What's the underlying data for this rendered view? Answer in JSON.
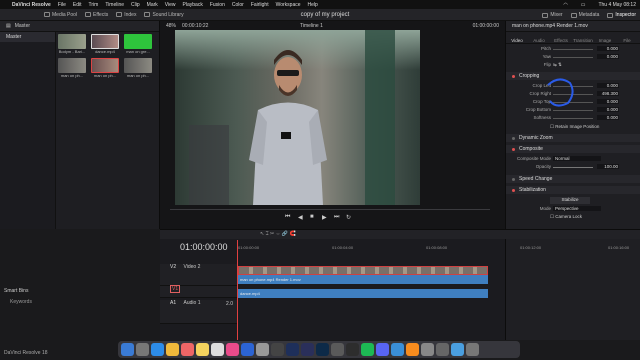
{
  "menubar": {
    "apple": "",
    "app": "DaVinci Resolve",
    "items": [
      "File",
      "Edit",
      "Trim",
      "Timeline",
      "Clip",
      "Mark",
      "View",
      "Playback",
      "Fusion",
      "Color",
      "Fairlight",
      "Workspace",
      "Help"
    ],
    "clock": "Thu 4 May  08:12"
  },
  "toolbar": {
    "media_pool": "Media Pool",
    "effects": "Effects",
    "index": "Index",
    "sound_library": "Sound Library",
    "project_title": "copy of my project",
    "mixer": "Mixer",
    "metadata": "Metadata",
    "inspector": "Inspector"
  },
  "viewer": {
    "zoom": "48%",
    "timecode_left": "00:00:10:22",
    "timeline_name": "Timeline 1",
    "timecode_right": "01:00:00:00"
  },
  "bins": {
    "master": "Master",
    "smart_bins": "Smart Bins",
    "keywords": "Keywords"
  },
  "clips": [
    {
      "label": "Bodym - Bari..."
    },
    {
      "label": "dance.mp4"
    },
    {
      "label": "man on gre..."
    },
    {
      "label": "man on ph..."
    },
    {
      "label": "man on ph..."
    },
    {
      "label": "man on ph..."
    }
  ],
  "inspector": {
    "clip_name": "man on phone.mp4 Render 1.mov",
    "tabs": [
      "Video",
      "Audio",
      "Effects",
      "Transition",
      "Image",
      "File"
    ],
    "rows_top": [
      {
        "label": "Pitch",
        "value": "0.000"
      },
      {
        "label": "Yaw",
        "value": "0.000"
      },
      {
        "label": "Flip",
        "value": ""
      }
    ],
    "cropping": "Cropping",
    "crop_rows": [
      {
        "label": "Crop Left",
        "value": "0.000"
      },
      {
        "label": "Crop Right",
        "value": "498.300"
      },
      {
        "label": "Crop Top",
        "value": "0.000"
      },
      {
        "label": "Crop Bottom",
        "value": "0.000"
      },
      {
        "label": "Softness",
        "value": "0.000"
      }
    ],
    "retain": "Retain Image Position",
    "dynamic_zoom": "Dynamic Zoom",
    "composite": "Composite",
    "composite_mode_label": "Composite Mode",
    "composite_mode_value": "Normal",
    "opacity_label": "Opacity",
    "opacity_value": "100.00",
    "speed_change": "Speed Change",
    "stabilization": "Stabilization",
    "stabilize_btn": "Stabilize",
    "mode_label": "Mode",
    "mode_value": "Perspective",
    "camera_lock": "Camera Lock"
  },
  "timeline": {
    "timecode": "01:00:00:00",
    "ruler": [
      "01:00:00:00",
      "01:00:04:00",
      "01:00:08:00",
      "01:00:12:00",
      "01:00:16:00"
    ],
    "tracks": [
      {
        "id": "V2",
        "name": "Video 2"
      },
      {
        "id": "V1",
        "name": ""
      },
      {
        "id": "A1",
        "name": "Audio 1"
      }
    ],
    "clip_v2": "man on phone.mp4 Render 1.mov",
    "clip_v1": "dance.mp4",
    "audio_level": "2.0"
  },
  "version": "DaVinci Resolve 18",
  "colors": {
    "accent": "#e04040",
    "clip_blue": "#3f7fc0",
    "annotation": "#2a5be8"
  }
}
